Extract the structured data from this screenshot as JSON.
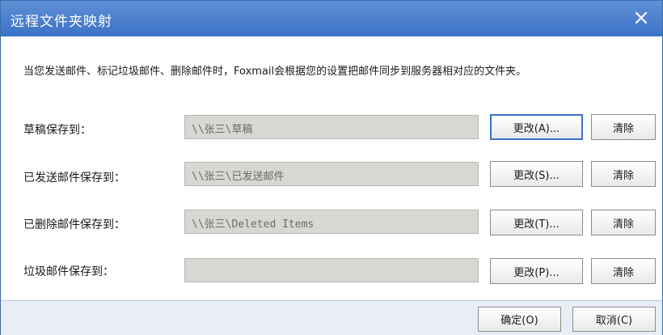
{
  "dialog": {
    "title": "远程文件夹映射",
    "close_icon": "close-icon",
    "description": "当您发送邮件、标记垃圾邮件、删除邮件时，Foxmail会根据您的设置把邮件同步到服务器相对应的文件夹。"
  },
  "rows": [
    {
      "label": "草稿保存到：",
      "value": "\\\\张三\\草稿",
      "change": "更改(A)...",
      "clear": "清除"
    },
    {
      "label": "已发送邮件保存到：",
      "value": "\\\\张三\\已发送邮件",
      "change": "更改(S)...",
      "clear": "清除"
    },
    {
      "label": "已删除邮件保存到：",
      "value": "\\\\张三\\Deleted Items",
      "change": "更改(T)...",
      "clear": "清除"
    },
    {
      "label": "垃圾邮件保存到：",
      "value": "",
      "change": "更改(P)...",
      "clear": "清除"
    }
  ],
  "footer": {
    "ok": "确定(O)",
    "cancel": "取消(C)"
  }
}
